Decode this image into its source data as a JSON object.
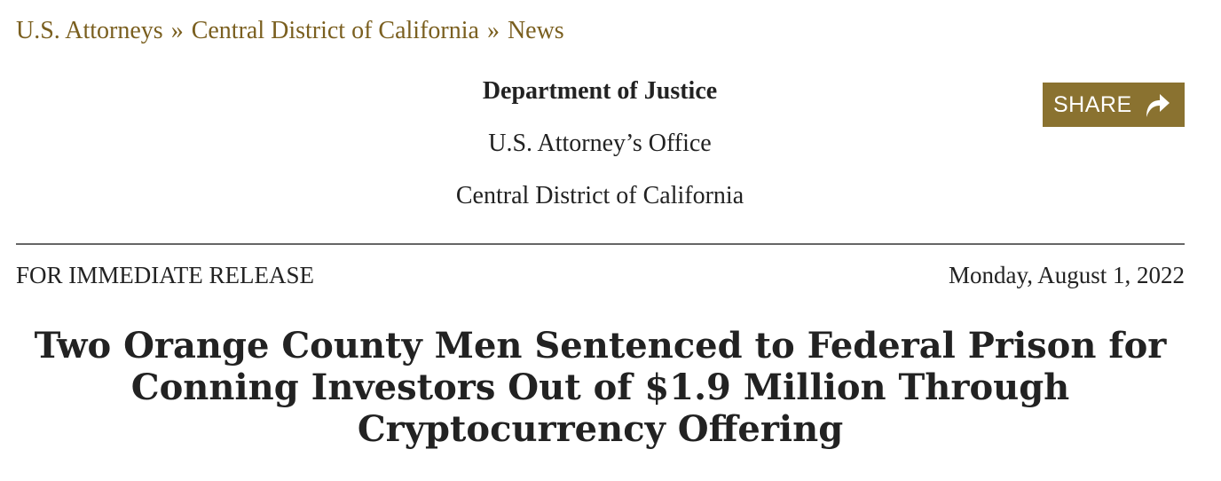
{
  "breadcrumb": {
    "items": [
      "U.S. Attorneys",
      "Central District of California",
      "News"
    ],
    "separator": "»"
  },
  "agency": {
    "department": "Department of Justice",
    "office": "U.S. Attorney’s Office",
    "district": "Central District of California"
  },
  "share": {
    "label": "SHARE",
    "icon": "share-arrow-icon",
    "color": "#8a7230"
  },
  "release": {
    "label": "FOR IMMEDIATE RELEASE",
    "date": "Monday, August 1, 2022"
  },
  "headline": "Two Orange County Men Sentenced to Federal Prison for Conning Investors Out of $1.9 Million Through Cryptocurrency Offering",
  "colors": {
    "link": "#7a5f1f",
    "text": "#222222",
    "divider": "#666666"
  }
}
